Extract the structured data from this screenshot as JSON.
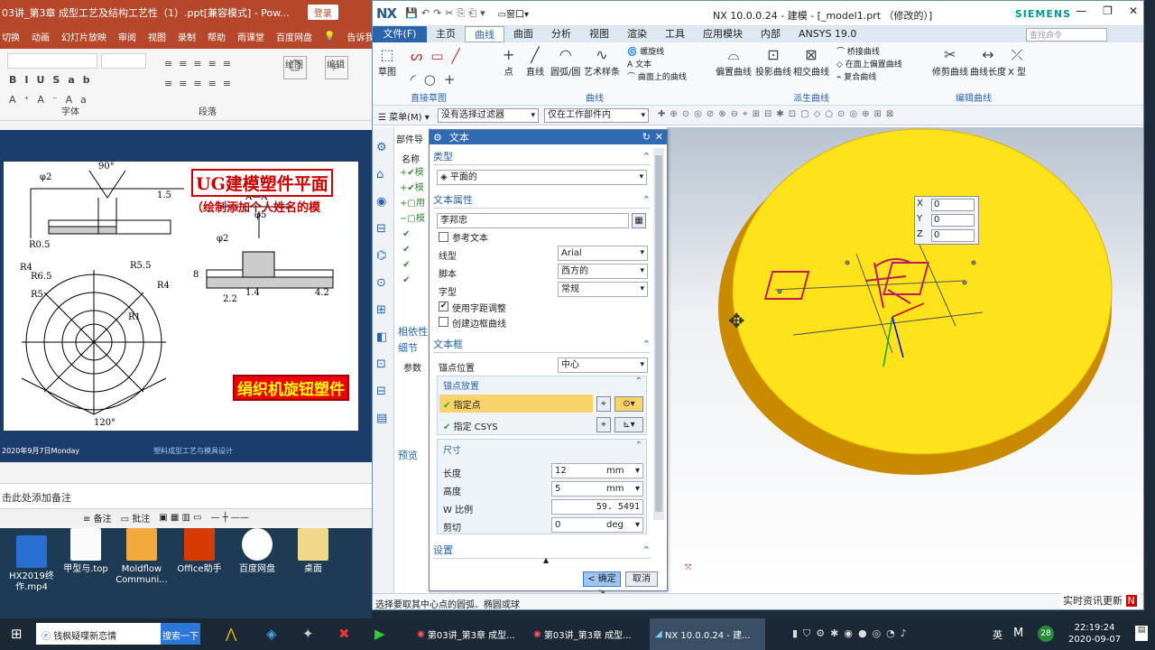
{
  "ppt": {
    "title": "03讲_第3章 成型工艺及结构工艺性（1）.ppt[兼容模式] - Pow...",
    "login": "登录",
    "tabs": [
      "切换",
      "动画",
      "幻灯片放映",
      "审阅",
      "视图",
      "录制",
      "帮助",
      "雨课堂",
      "百度网盘",
      "告诉我"
    ],
    "groups": [
      "字体",
      "段落",
      "绘图",
      "编辑"
    ],
    "slide": {
      "title": "UG建模塑件平面",
      "subtitle": "（绘制添加个人姓名的模",
      "subtitle2": "绢织机旋钮塑件",
      "date": "2020年9月7日Monday",
      "footer": "塑料成型工艺与模具设计"
    },
    "notes": "击此处添加备注",
    "status": {
      "notes": "备注",
      "comments": "批注"
    }
  },
  "desktop": [
    {
      "label": "HX2019终作.mp4"
    },
    {
      "label": "甲型与.top"
    },
    {
      "label": "Moldflow Communi..."
    },
    {
      "label": "Office助手"
    },
    {
      "label": "百度网盘"
    },
    {
      "label": "桌面"
    }
  ],
  "nx": {
    "logo": "NX",
    "title": "NX 10.0.0.24 - 建模 - [_model1.prt （修改的）]",
    "brand": "SIEMENS",
    "window_menu": "窗口",
    "tabs": [
      "文件(F)",
      "主页",
      "曲线",
      "曲面",
      "分析",
      "视图",
      "渲染",
      "工具",
      "应用模块",
      "内部",
      "ANSYS 19.0"
    ],
    "active_tab": "曲线",
    "search_placeholder": "查找命令",
    "ribbon": {
      "groups": [
        "直接草图",
        "曲线",
        "派生曲线",
        "编辑曲线"
      ],
      "buttons": [
        "草图",
        "点",
        "直线",
        "圆弧/圆",
        "艺术样条",
        "螺旋线",
        "文本",
        "曲面上的曲线",
        "偏置曲线",
        "投影曲线",
        "相交曲线",
        "桥接曲线",
        "在面上偏置曲线",
        "复合曲线",
        "修剪曲线",
        "曲线长度",
        "X 型"
      ]
    },
    "filter": {
      "menu": "菜单(M)",
      "filter1": "没有选择过滤器",
      "filter2": "仅在工作部件内"
    },
    "nav": {
      "header": "部件导",
      "name_col": "名称",
      "items": [
        "模",
        "模",
        "用",
        "模"
      ],
      "depend": "相依性",
      "detail": "细节",
      "param": "参数",
      "preview": "预览"
    },
    "status": "选择要取其中心点的圆弧、椭圆或球",
    "coords": {
      "x": "0",
      "y": "0",
      "z": "0"
    }
  },
  "dialog": {
    "title": "文本",
    "type_section": "类型",
    "type_value": "平面的",
    "props_section": "文本属性",
    "text_value": "李邦忠",
    "ref_text": "参考文本",
    "font_label": "线型",
    "font_value": "Arial",
    "script_label": "脚本",
    "script_value": "西方的",
    "style_label": "字型",
    "style_value": "常规",
    "kerning": "使用字距调整",
    "frame": "创建边框曲线",
    "frame_section": "文本框",
    "anchor_label": "锚点位置",
    "anchor_value": "中心",
    "anchor_place": "锚点放置",
    "specify_point": "指定点",
    "specify_csys": "指定 CSYS",
    "dim_section": "尺寸",
    "length_label": "长度",
    "length_value": "12",
    "length_unit": "mm",
    "height_label": "高度",
    "height_value": "5",
    "height_unit": "mm",
    "wscale_label": "W 比例",
    "wscale_value": "59. 5491",
    "shear_label": "剪切",
    "shear_value": "0",
    "shear_unit": "deg",
    "settings_section": "设置",
    "ok": "< 确定 >",
    "cancel": "取消"
  },
  "taskbar": {
    "search_text": "钱枫疑喋新恋情",
    "search_btn": "搜索一下",
    "apps": [
      "第03讲_第3章 成型...",
      "第03讲_第3章 成型...",
      "NX 10.0.0.24 - 建..."
    ],
    "time": "22:19:24",
    "date": "2020-09-07",
    "lang": "英",
    "badge": "28"
  },
  "news": "实时资讯更新"
}
